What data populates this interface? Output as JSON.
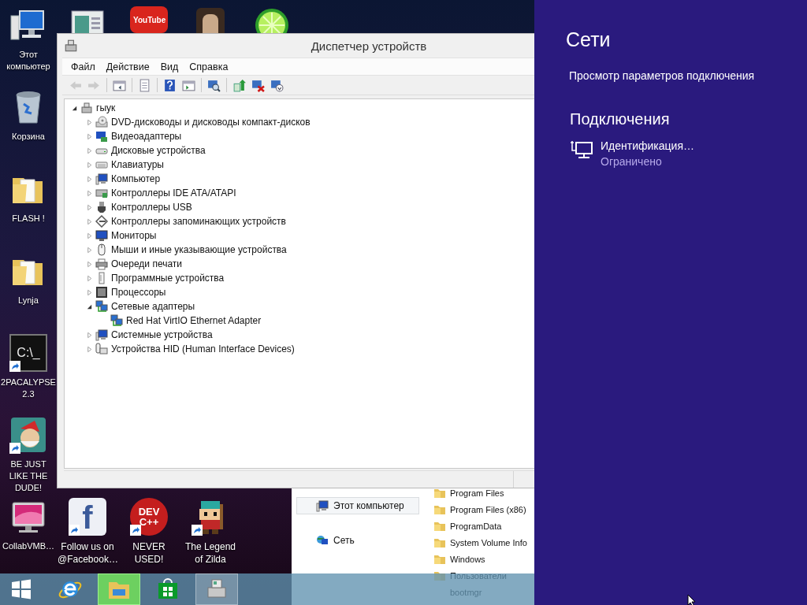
{
  "desktop": {
    "icons": [
      {
        "kind": "computer",
        "label": "Этот компьютер",
        "shortcut": false
      },
      {
        "kind": "app-window",
        "shortcut": false
      },
      {
        "kind": "youtube",
        "logo_text": "YouTube",
        "shortcut": false
      },
      {
        "kind": "portrait",
        "shortcut": false
      },
      {
        "kind": "lime",
        "shortcut": false
      },
      {
        "kind": "recycle-bin",
        "label": "Корзина",
        "shortcut": false
      },
      {
        "kind": "folder",
        "label": "FLASH !",
        "shortcut": false
      },
      {
        "kind": "folder",
        "label": "Lynja",
        "shortcut": false
      },
      {
        "kind": "console",
        "logo_text": "C:\\_",
        "label": "2PACALYPSE 2.3",
        "shortcut": true
      },
      {
        "kind": "elf",
        "label": "BE JUST LIKE THE DUDE!",
        "shortcut": true
      },
      {
        "kind": "monitor",
        "label": "CollabVMB…",
        "shortcut": false
      },
      {
        "kind": "facebook",
        "logo_text": "f",
        "label": "Follow us on @Facebook…",
        "shortcut": true
      },
      {
        "kind": "devcpp",
        "logo_text": "DEV C++",
        "label": "NEVER USED!",
        "shortcut": true
      },
      {
        "kind": "pixel-hero",
        "label": "The Legend of Zilda",
        "shortcut": true
      }
    ]
  },
  "device_manager": {
    "title": "Диспетчер устройств",
    "menu": [
      "Файл",
      "Действие",
      "Вид",
      "Справка"
    ],
    "toolbar_groups": [
      {
        "buttons": [
          {
            "kind": "back",
            "disabled": true
          },
          {
            "kind": "forward",
            "disabled": true
          }
        ]
      },
      {
        "buttons": [
          {
            "kind": "console-tree",
            "disabled": false
          }
        ]
      },
      {
        "buttons": [
          {
            "kind": "properties",
            "disabled": false
          }
        ]
      },
      {
        "buttons": [
          {
            "kind": "help",
            "disabled": false
          },
          {
            "kind": "action-pane",
            "disabled": false
          }
        ]
      },
      {
        "buttons": [
          {
            "kind": "scan",
            "disabled": false
          }
        ]
      },
      {
        "buttons": [
          {
            "kind": "update",
            "disabled": false
          },
          {
            "kind": "disable",
            "disabled": false
          },
          {
            "kind": "uninstall",
            "disabled": false
          }
        ]
      }
    ],
    "tree": {
      "label": "гыук",
      "kind": "root",
      "expanded": true,
      "children": [
        {
          "label": "DVD-дисководы и дисководы компакт-дисков",
          "kind": "dvd",
          "expanded": false
        },
        {
          "label": "Видеоадаптеры",
          "kind": "display",
          "expanded": false
        },
        {
          "label": "Дисковые устройства",
          "kind": "disk",
          "expanded": false
        },
        {
          "label": "Клавиатуры",
          "kind": "keyboard",
          "expanded": false
        },
        {
          "label": "Компьютер",
          "kind": "computer",
          "expanded": false
        },
        {
          "label": "Контроллеры IDE ATA/ATAPI",
          "kind": "ide",
          "expanded": false
        },
        {
          "label": "Контроллеры USB",
          "kind": "usb",
          "expanded": false
        },
        {
          "label": "Контроллеры запоминающих устройств",
          "kind": "storage",
          "expanded": false
        },
        {
          "label": "Мониторы",
          "kind": "monitor",
          "expanded": false
        },
        {
          "label": "Мыши и иные указывающие устройства",
          "kind": "mouse",
          "expanded": false
        },
        {
          "label": "Очереди печати",
          "kind": "printer",
          "expanded": false
        },
        {
          "label": "Программные устройства",
          "kind": "software",
          "expanded": false
        },
        {
          "label": "Процессоры",
          "kind": "cpu",
          "expanded": false
        },
        {
          "label": "Сетевые адаптеры",
          "kind": "network",
          "expanded": true,
          "children": [
            {
              "label": "Red Hat VirtIO Ethernet Adapter",
              "kind": "network"
            }
          ]
        },
        {
          "label": "Системные устройства",
          "kind": "computer",
          "expanded": false
        },
        {
          "label": "Устройства HID (Human Interface Devices)",
          "kind": "hid",
          "expanded": false
        }
      ]
    }
  },
  "explorer": {
    "nav": [
      {
        "label": "Этот компьютер",
        "kind": "computer",
        "selected": true
      },
      {
        "label": "Сеть",
        "kind": "network",
        "selected": false
      }
    ],
    "files": [
      {
        "name": "Program Files",
        "kind": "folder"
      },
      {
        "name": "Program Files (x86)",
        "kind": "folder"
      },
      {
        "name": "ProgramData",
        "kind": "folder"
      },
      {
        "name": "System Volume Info",
        "kind": "folder"
      },
      {
        "name": "Windows",
        "kind": "folder"
      },
      {
        "name": "Пользователи",
        "kind": "folder"
      },
      {
        "name": "bootmgr",
        "kind": "file"
      }
    ]
  },
  "taskbar": {
    "items": [
      {
        "kind": "start",
        "running": false,
        "hovered": false
      },
      {
        "kind": "ie",
        "running": false,
        "hovered": false
      },
      {
        "kind": "explorer",
        "running": true,
        "hovered": true
      },
      {
        "kind": "store",
        "running": false,
        "hovered": false
      },
      {
        "kind": "device-manager",
        "running": true,
        "hovered": false
      }
    ]
  },
  "network_flyout": {
    "title": "Сети",
    "settings_link": "Просмотр параметров подключения",
    "section": "Подключения",
    "connections": [
      {
        "name": "Идентификация…",
        "status": "Ограничено"
      }
    ]
  }
}
